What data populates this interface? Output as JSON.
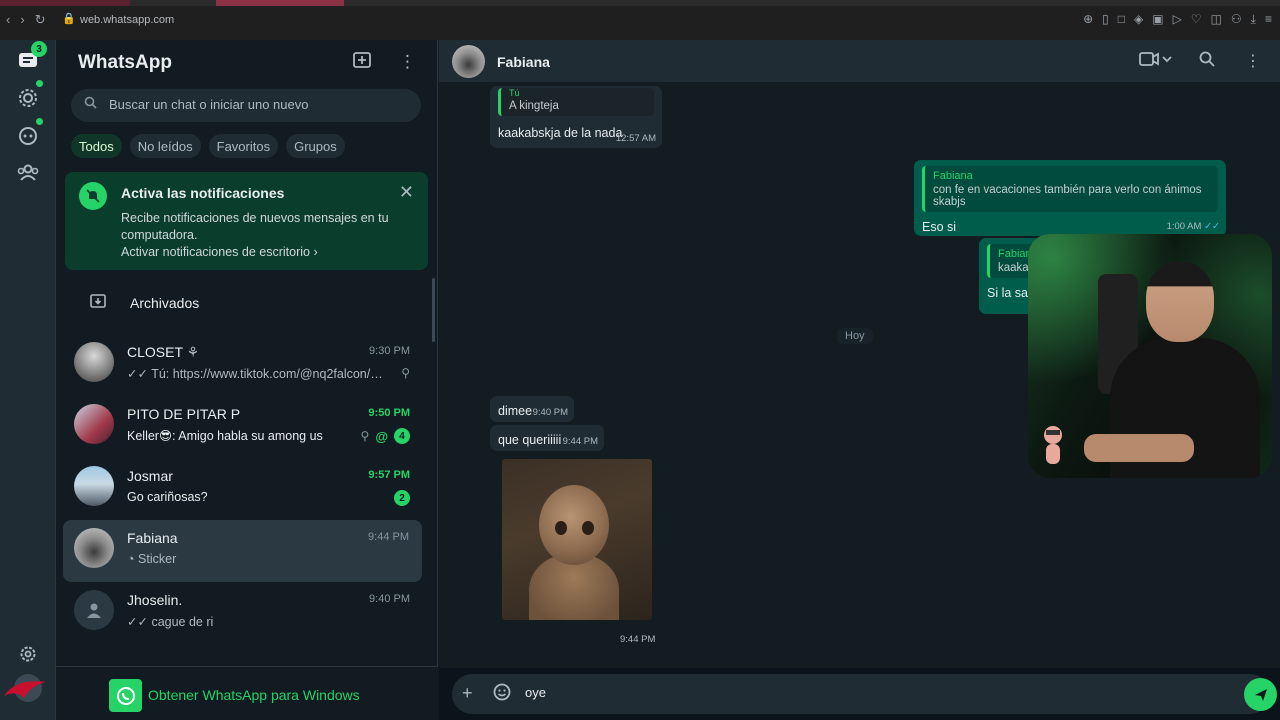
{
  "browser": {
    "url": "web.whatsapp.com"
  },
  "rail": {
    "chats_badge": "3"
  },
  "sidebar": {
    "title": "WhatsApp",
    "search_placeholder": "Buscar un chat o iniciar uno nuevo",
    "filters": [
      {
        "label": "Todos",
        "active": true
      },
      {
        "label": "No leídos",
        "active": false
      },
      {
        "label": "Favoritos",
        "active": false
      },
      {
        "label": "Grupos",
        "active": false
      }
    ],
    "notification": {
      "title": "Activa las notificaciones",
      "body": "Recibe notificaciones de nuevos mensajes en tu computadora.",
      "link": "Activar notificaciones de escritorio"
    },
    "archived_label": "Archivados",
    "chats": [
      {
        "name": "CLOSET",
        "time": "9:30 PM",
        "preview": "Tú: https://www.tiktok.com/@nq2falcon/vide...",
        "unread": ""
      },
      {
        "name": "PITO DE PITAR P",
        "time": "9:50 PM",
        "preview": "Keller😎: Amigo habla su among us",
        "unread": "4"
      },
      {
        "name": "Josmar",
        "time": "9:57 PM",
        "preview": "Go cariñosas?",
        "unread": "2"
      },
      {
        "name": "Fabiana",
        "time": "9:44 PM",
        "preview": "Sticker",
        "unread": ""
      },
      {
        "name": "Jhoselin.",
        "time": "9:40 PM",
        "preview": "cague de ri",
        "unread": ""
      }
    ],
    "get_app_label": "Obtener WhatsApp para Windows"
  },
  "conversation": {
    "contact_name": "Fabiana",
    "day_separator": "Hoy",
    "messages": [
      {
        "quote_author": "Tú",
        "quote_text": "A kingteja",
        "text": "kaakabskja de la nada",
        "time": "12:57 AM"
      },
      {
        "quote_author": "Fabiana",
        "quote_text": "con fe en vacaciones también para verlo con ánimos skabjs",
        "text": "Eso si",
        "time": "1:00 AM"
      },
      {
        "quote_author": "Fabiana",
        "quote_text": "kaakabs",
        "text": "Si la san"
      },
      {
        "text": "dimee",
        "time": "9:40 PM"
      },
      {
        "text": "que queriiiii",
        "time": "9:44 PM"
      }
    ],
    "sticker_time": "9:44 PM",
    "composer_value": "oye"
  },
  "colors": {
    "accent": "#25d366",
    "panel_bg": "#111b21",
    "header_bg": "#202c33",
    "outgoing_bubble": "#005c4b"
  }
}
